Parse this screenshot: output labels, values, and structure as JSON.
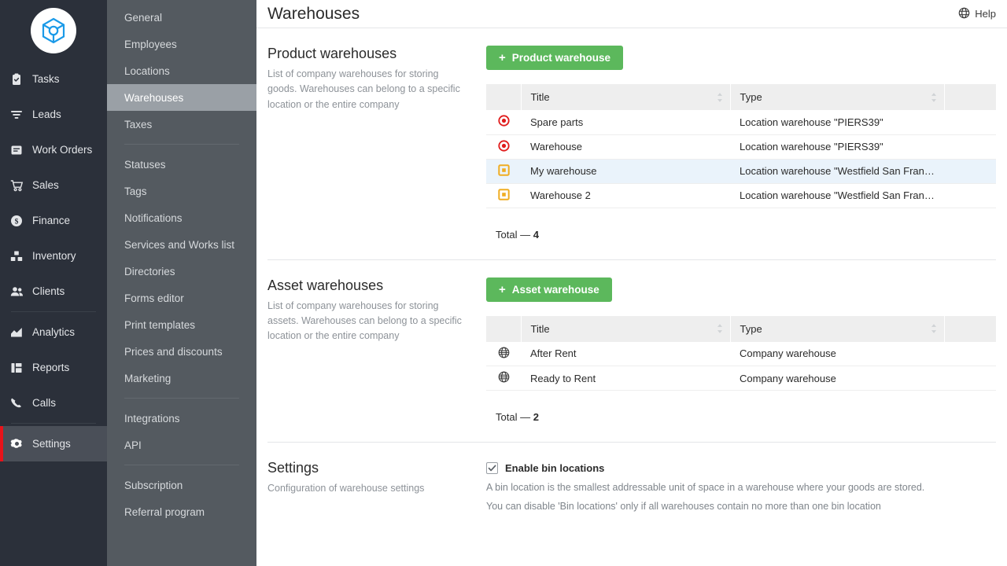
{
  "brand": {
    "logo_icon": "cube-logo-icon",
    "accent_green": "#5cb85c",
    "accent_red": "#e8131a"
  },
  "sidebar": {
    "items": [
      {
        "label": "Tasks",
        "icon": "clipboard-check-icon"
      },
      {
        "label": "Leads",
        "icon": "funnel-icon"
      },
      {
        "label": "Work Orders",
        "icon": "inbox-icon"
      },
      {
        "label": "Sales",
        "icon": "shopping-cart-icon"
      },
      {
        "label": "Finance",
        "icon": "dollar-circle-icon"
      },
      {
        "label": "Inventory",
        "icon": "boxes-icon"
      },
      {
        "label": "Clients",
        "icon": "people-icon"
      },
      {
        "label": "Analytics",
        "icon": "chart-area-icon"
      },
      {
        "label": "Reports",
        "icon": "grid-report-icon"
      },
      {
        "label": "Calls",
        "icon": "phone-icon"
      },
      {
        "label": "Settings",
        "icon": "gear-icon"
      }
    ],
    "active": "Settings"
  },
  "subnav": {
    "groups": [
      {
        "items": [
          "General",
          "Employees",
          "Locations",
          "Warehouses",
          "Taxes"
        ]
      },
      {
        "items": [
          "Statuses",
          "Tags",
          "Notifications",
          "Services and Works list",
          "Directories",
          "Forms editor",
          "Print templates",
          "Prices and discounts",
          "Marketing"
        ]
      },
      {
        "items": [
          "Integrations",
          "API"
        ]
      },
      {
        "items": [
          "Subscription",
          "Referral program"
        ]
      }
    ],
    "active": "Warehouses"
  },
  "header": {
    "title": "Warehouses",
    "help_label": "Help",
    "help_icon": "globe-help-icon"
  },
  "product_section": {
    "title": "Product warehouses",
    "description": "List of company warehouses for storing goods. Warehouses can belong to a specific location or the entire company",
    "add_button": "Product warehouse",
    "add_icon": "plus-icon",
    "columns": [
      "Title",
      "Type"
    ],
    "rows": [
      {
        "icon": "red-target-icon",
        "title": "Spare parts",
        "type": "Location warehouse \"PIERS39\"",
        "selected": false
      },
      {
        "icon": "red-target-icon",
        "title": "Warehouse",
        "type": "Location warehouse \"PIERS39\"",
        "selected": false
      },
      {
        "icon": "orange-square-icon",
        "title": "My warehouse",
        "type": "Location warehouse \"Westfield San Francisco Cent...",
        "selected": true
      },
      {
        "icon": "orange-square-icon",
        "title": "Warehouse 2",
        "type": "Location warehouse \"Westfield San Francisco Cent...",
        "selected": false
      }
    ],
    "total_label": "Total —",
    "total_value": "4"
  },
  "asset_section": {
    "title": "Asset warehouses",
    "description": "List of company warehouses for storing assets. Warehouses can belong to a specific location or the entire company",
    "add_button": "Asset warehouse",
    "add_icon": "plus-icon",
    "columns": [
      "Title",
      "Type"
    ],
    "rows": [
      {
        "icon": "globe-icon",
        "title": "After Rent",
        "type": "Company warehouse",
        "selected": false
      },
      {
        "icon": "globe-icon",
        "title": "Ready to Rent",
        "type": "Company warehouse",
        "selected": false
      }
    ],
    "total_label": "Total —",
    "total_value": "2"
  },
  "settings_section": {
    "title": "Settings",
    "description": "Configuration of warehouse settings",
    "checkbox_label": "Enable bin locations",
    "checkbox_checked": true,
    "note_line1": "A bin location is the smallest addressable unit of space in a warehouse where your goods are stored.",
    "note_line2": "You can disable 'Bin locations' only if all warehouses contain no more than one bin location"
  }
}
